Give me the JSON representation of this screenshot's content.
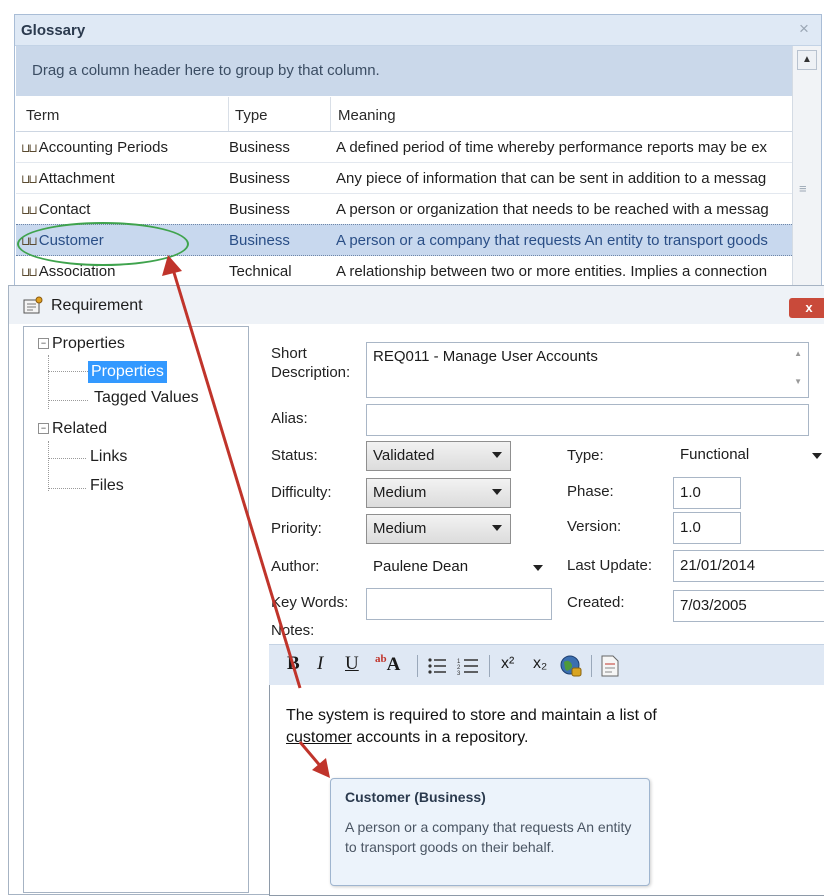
{
  "glossary": {
    "title": "Glossary",
    "close_glyph": "×",
    "group_hint": "Drag a column header here to group by that column.",
    "columns": [
      "Term",
      "Type",
      "Meaning"
    ],
    "rows": [
      {
        "term": "Accounting Periods",
        "type": "Business",
        "meaning": "A defined period of time whereby performance  reports may be ex"
      },
      {
        "term": "Attachment",
        "type": "Business",
        "meaning": "Any piece of information that can be sent in addition to a messag"
      },
      {
        "term": "Contact",
        "type": "Business",
        "meaning": "A person or organization that needs to be reached with a messag"
      },
      {
        "term": "Customer",
        "type": "Business",
        "meaning": "A person or a company that requests An entity to transport goods"
      },
      {
        "term": "Association",
        "type": "Technical",
        "meaning": "A relationship between two or more entities. Implies a connection"
      }
    ]
  },
  "requirement": {
    "title": "Requirement",
    "close_glyph": "x",
    "tree": {
      "properties_group": "Properties",
      "properties_item": "Properties",
      "tagged_values": "Tagged Values",
      "related_group": "Related",
      "links": "Links",
      "files": "Files"
    },
    "form": {
      "short_description_label": "Short Description:",
      "short_description_value": "REQ011 - Manage User Accounts",
      "alias_label": "Alias:",
      "alias_value": "",
      "status_label": "Status:",
      "status_value": "Validated",
      "difficulty_label": "Difficulty:",
      "difficulty_value": "Medium",
      "priority_label": "Priority:",
      "priority_value": "Medium",
      "author_label": "Author:",
      "author_value": "Paulene Dean",
      "keywords_label": "Key Words:",
      "keywords_value": "",
      "type_label": "Type:",
      "type_value": "Functional",
      "phase_label": "Phase:",
      "phase_value": "1.0",
      "version_label": "Version:",
      "version_value": "1.0",
      "last_update_label": "Last Update:",
      "last_update_value": "21/01/2014",
      "created_label": "Created:",
      "created_value": "7/03/2005",
      "notes_label": "Notes:"
    },
    "toolbar": {
      "bold": "B",
      "italic": "I",
      "underline": "U",
      "font_color": "A",
      "superscript": "x²",
      "subscript": "x₂"
    },
    "notes": {
      "line1": "The system is required to store and maintain a list of",
      "link_word": "customer",
      "line2_rest": " accounts in a repository."
    }
  },
  "tooltip": {
    "title": "Customer (Business)",
    "body": "A person or a company that requests An entity to transport goods on their behalf."
  },
  "colors": {
    "selection": "#3399ff",
    "annotation_arrow": "#c0342b",
    "annotation_ellipse": "#3fa34d",
    "close_button": "#c94a3a"
  }
}
